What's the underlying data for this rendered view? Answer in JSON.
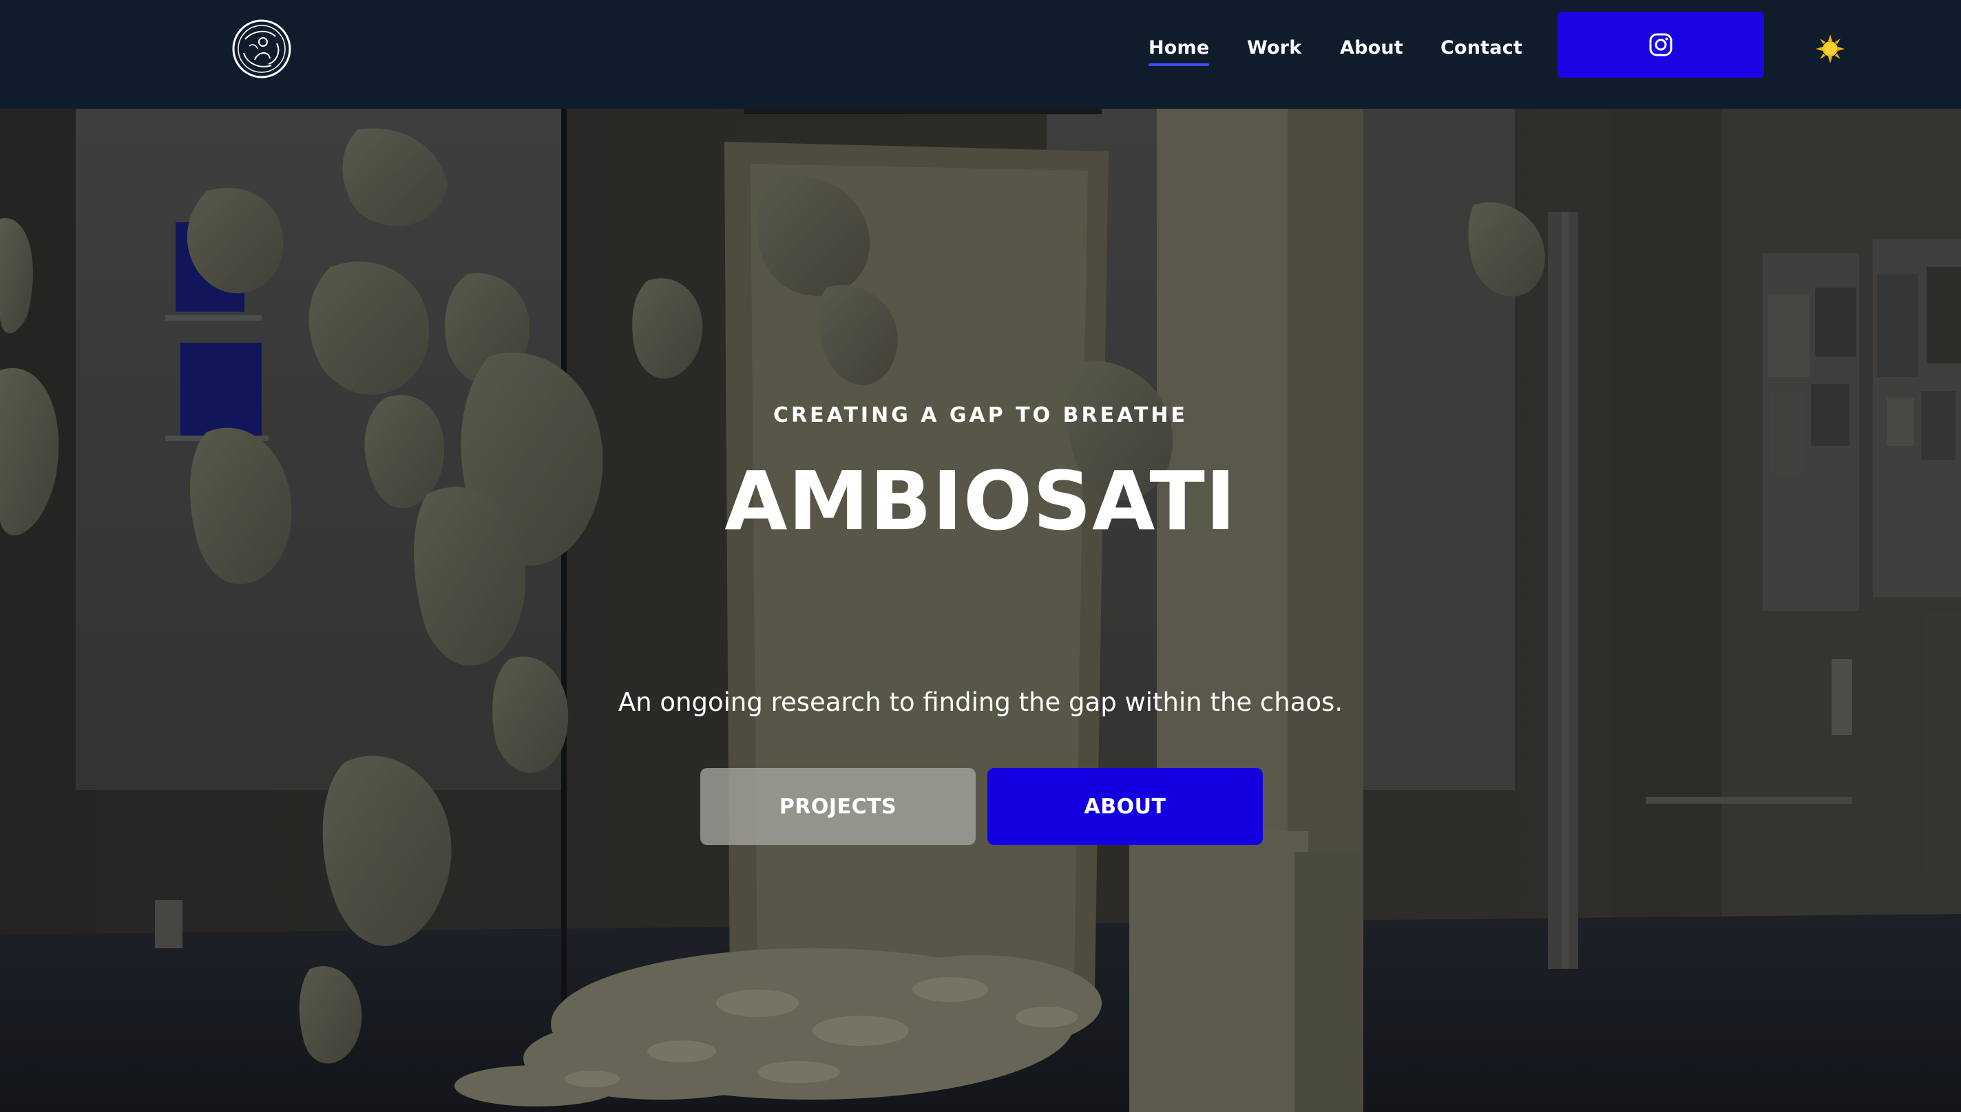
{
  "nav": {
    "logo": "ambiosati-logo",
    "links": [
      {
        "label": "Home",
        "active": true
      },
      {
        "label": "Work",
        "active": false
      },
      {
        "label": "About",
        "active": false
      },
      {
        "label": "Contact",
        "active": false
      }
    ],
    "instagram_icon": "instagram-icon",
    "theme_toggle_icon": "sun-icon"
  },
  "hero": {
    "eyebrow": "CREATING A GAP TO BREATHE",
    "title": "AMBIOSATI",
    "tagline": "An ongoing research to finding the gap within the chaos.",
    "buttons": {
      "projects": "PROJECTS",
      "about": "ABOUT"
    },
    "background": "exhibition-installation-photo"
  },
  "colors": {
    "navbar_bg": "#0e1c2c",
    "accent_blue": "#1a06e2",
    "active_underline": "#3f4cf5",
    "ghost_button": "#a5a5a0"
  }
}
